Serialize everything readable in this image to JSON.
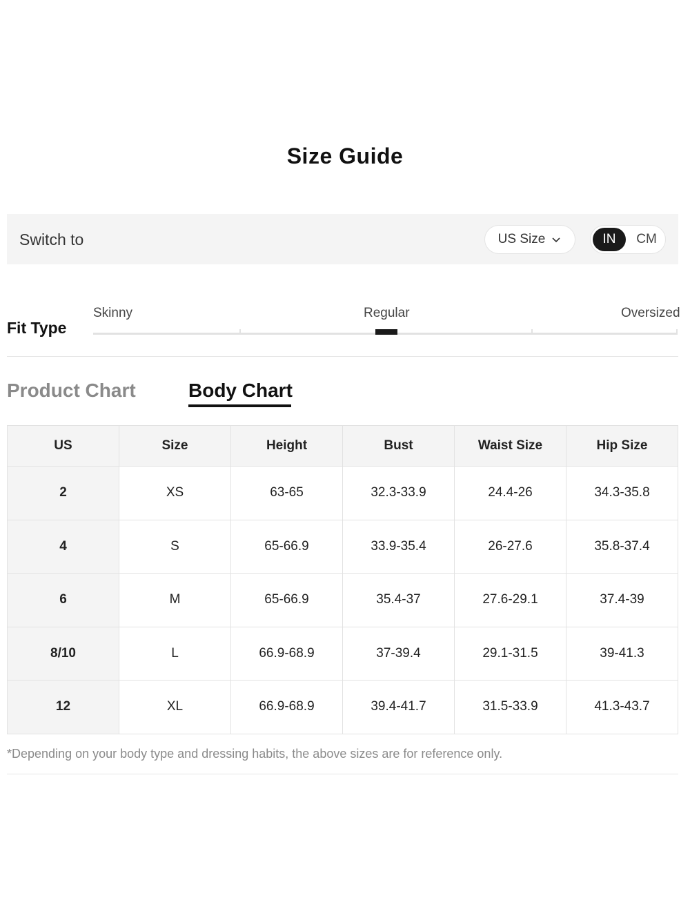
{
  "title": "Size Guide",
  "switch_bar": {
    "label": "Switch to",
    "size_select_value": "US Size",
    "units": [
      "IN",
      "CM"
    ],
    "active_unit": "IN"
  },
  "fit_type": {
    "label": "Fit Type",
    "options": [
      "Skinny",
      "Regular",
      "Oversized"
    ],
    "selected": "Regular"
  },
  "tabs": [
    {
      "label": "Product Chart",
      "active": false
    },
    {
      "label": "Body Chart",
      "active": true
    }
  ],
  "table": {
    "headers": [
      "US",
      "Size",
      "Height",
      "Bust",
      "Waist Size",
      "Hip Size"
    ],
    "rows": [
      [
        "2",
        "XS",
        "63-65",
        "32.3-33.9",
        "24.4-26",
        "34.3-35.8"
      ],
      [
        "4",
        "S",
        "65-66.9",
        "33.9-35.4",
        "26-27.6",
        "35.8-37.4"
      ],
      [
        "6",
        "M",
        "65-66.9",
        "35.4-37",
        "27.6-29.1",
        "37.4-39"
      ],
      [
        "8/10",
        "L",
        "66.9-68.9",
        "37-39.4",
        "29.1-31.5",
        "39-41.3"
      ],
      [
        "12",
        "XL",
        "66.9-68.9",
        "39.4-41.7",
        "31.5-33.9",
        "41.3-43.7"
      ]
    ]
  },
  "note": "*Depending on your body type and dressing habits, the above sizes are for reference only.",
  "icons": {
    "size_select": "chevron-down-icon"
  },
  "colors": {
    "accent": "#1a1a1a",
    "panel": "#f4f4f4",
    "muted": "#8a8a8a"
  }
}
